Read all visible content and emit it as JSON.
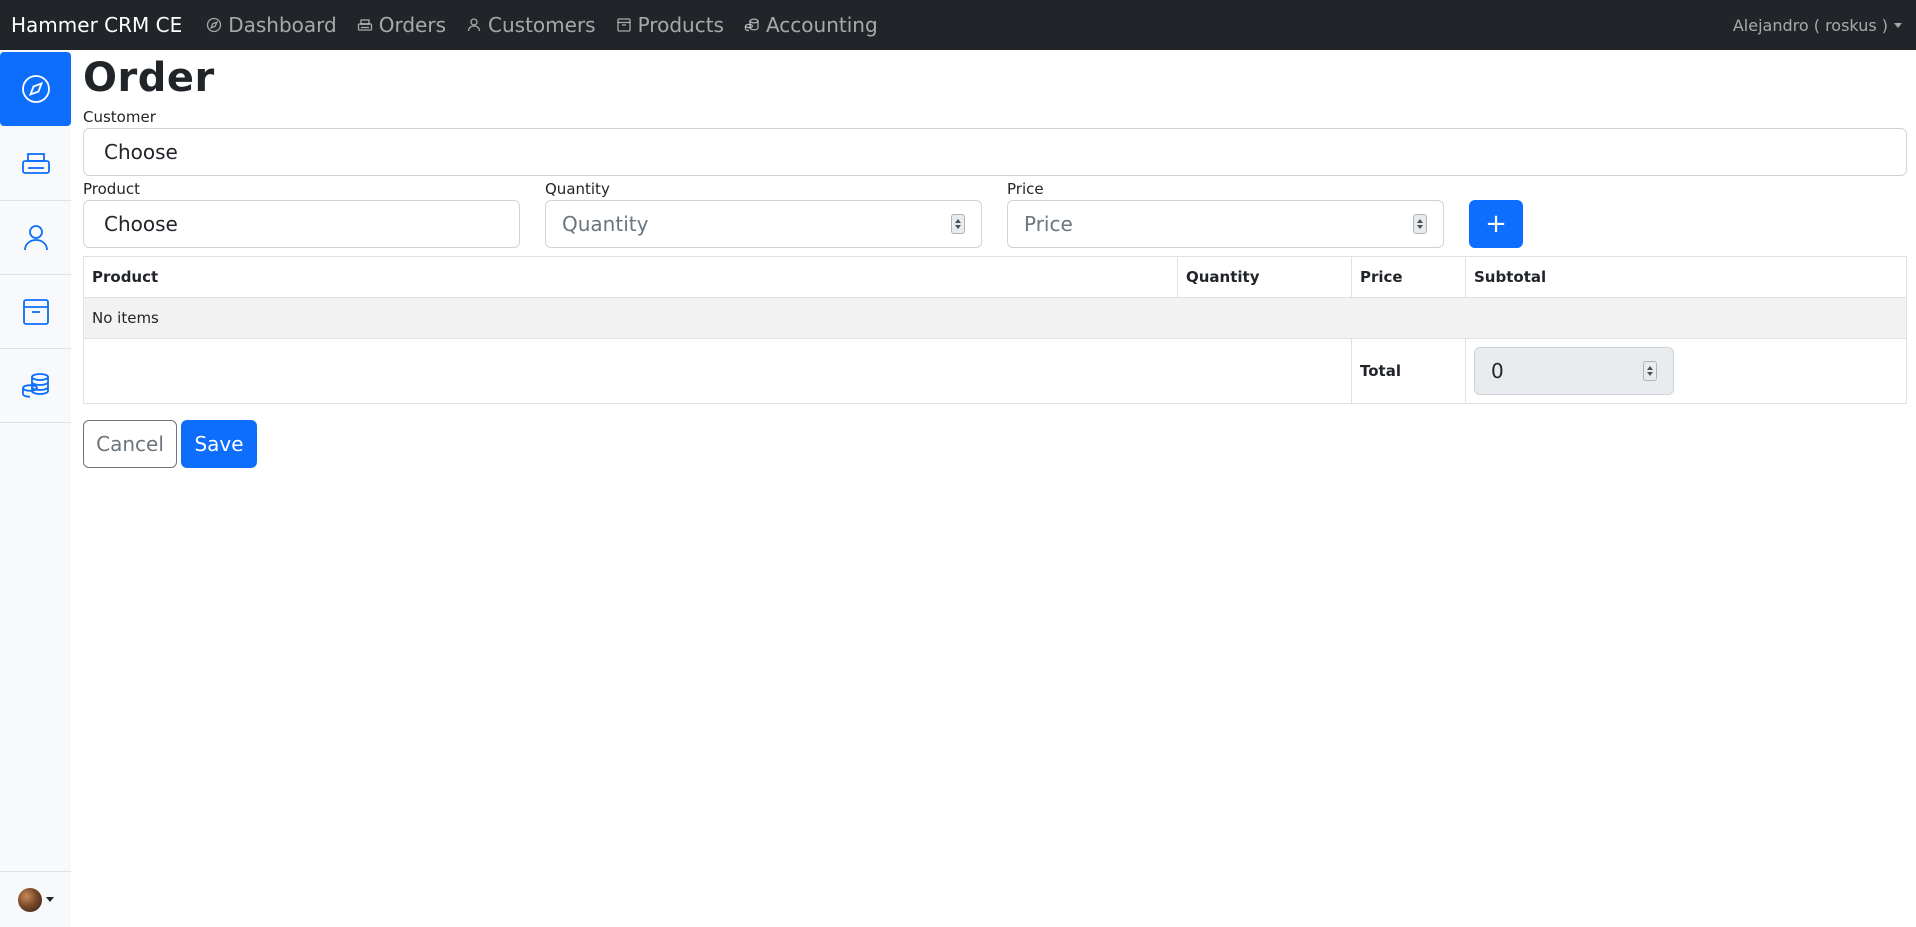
{
  "navbar": {
    "brand": "Hammer CRM CE",
    "links": [
      {
        "label": "Dashboard",
        "icon": "compass-icon"
      },
      {
        "label": "Orders",
        "icon": "printer-icon"
      },
      {
        "label": "Customers",
        "icon": "person-icon"
      },
      {
        "label": "Products",
        "icon": "box-icon"
      },
      {
        "label": "Accounting",
        "icon": "coins-icon"
      }
    ],
    "user": "Alejandro ( roskus )"
  },
  "sidebar": {
    "items": [
      {
        "icon": "compass-icon",
        "active": true
      },
      {
        "icon": "printer-icon",
        "active": false
      },
      {
        "icon": "person-icon",
        "active": false
      },
      {
        "icon": "box-icon",
        "active": false
      },
      {
        "icon": "coins-icon",
        "active": false
      }
    ]
  },
  "page": {
    "title": "Order",
    "customer_label": "Customer",
    "customer_value": "Choose",
    "product_label": "Product",
    "product_value": "Choose",
    "quantity_label": "Quantity",
    "quantity_placeholder": "Quantity",
    "price_label": "Price",
    "price_placeholder": "Price",
    "add_label": "+"
  },
  "table": {
    "columns": [
      "Product",
      "Quantity",
      "Price",
      "Subtotal"
    ],
    "empty_text": "No items",
    "total_label": "Total",
    "total_value": "0"
  },
  "actions": {
    "cancel_label": "Cancel",
    "save_label": "Save"
  },
  "colors": {
    "primary": "#0d6efd",
    "navbar": "#212529",
    "sidebar": "#f8f9fa"
  }
}
